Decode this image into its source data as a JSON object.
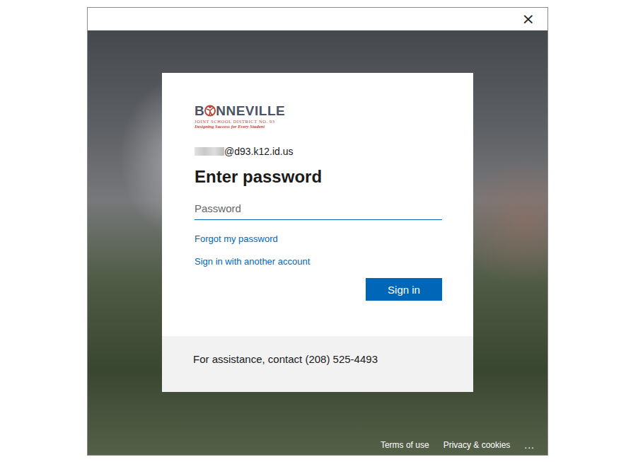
{
  "window": {
    "close": "×"
  },
  "logo": {
    "name_left": "B",
    "name_right": "NNEVILLE",
    "district": "JOINT SCHOOL DISTRICT NO. 93",
    "tagline": "Designing Success for Every Student"
  },
  "account": {
    "email_visible": "@d93.k12.id.us"
  },
  "heading": "Enter password",
  "password": {
    "placeholder": "Password",
    "focused": true
  },
  "links": [
    "Forgot my password",
    "Sign in with another account"
  ],
  "button": "Sign in",
  "assistance": "For assistance, contact (208) 525-4493",
  "footer_links": [
    "Terms of use",
    "Privacy & cookies"
  ],
  "more": "..."
}
